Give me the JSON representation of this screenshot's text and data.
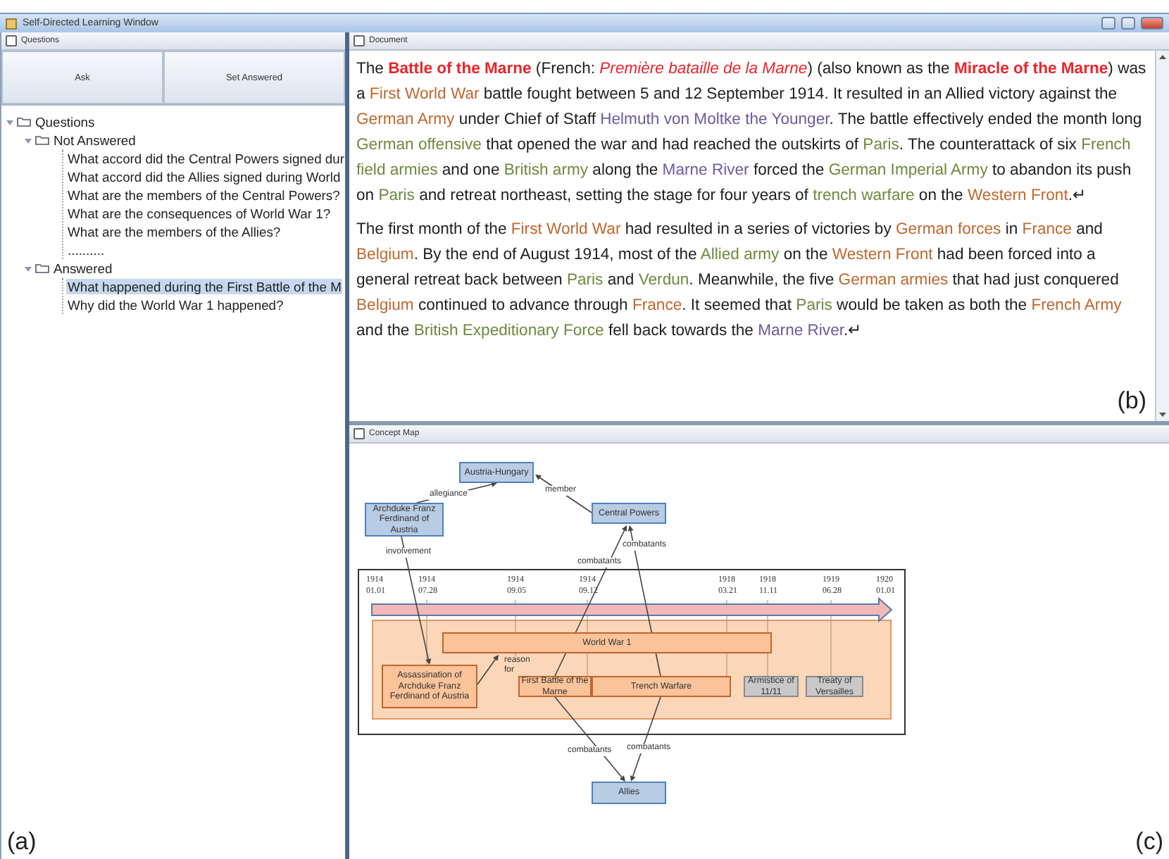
{
  "window": {
    "title": "Self-Directed Learning Window"
  },
  "questions_panel": {
    "title": "Questions",
    "buttons": [
      "Ask",
      "Set Answered"
    ],
    "tree": [
      {
        "label": "Questions",
        "expanded": true,
        "selected": false,
        "children": [
          {
            "label": "Not Answered",
            "expanded": true,
            "selected": false,
            "children": [
              {
                "label": "What accord did the Central Powers signed dur",
                "selected": false
              },
              {
                "label": "What accord did the Allies signed during World",
                "selected": false
              },
              {
                "label": "What are the members of the Central Powers?",
                "selected": false
              },
              {
                "label": "What are the consequences of World War 1?",
                "selected": false
              },
              {
                "label": "What are the members of the Allies?",
                "selected": false
              },
              {
                "label": "..........",
                "selected": false
              }
            ]
          },
          {
            "label": "Answered",
            "expanded": true,
            "selected": false,
            "children": [
              {
                "label": "What happened during the First Battle of the M",
                "selected": true
              },
              {
                "label": "Why did the World War 1 happened?",
                "selected": false
              }
            ]
          }
        ]
      }
    ],
    "caption": "(a)"
  },
  "document_panel": {
    "title": "Document",
    "paragraphs": [
      {
        "segments": [
          {
            "text": "The ",
            "kind": "plain",
            "color": "#1e1e1e"
          },
          {
            "text": "Battle of the Marne",
            "kind": "bold",
            "color": "#e8262a"
          },
          {
            "text": " (French: ",
            "kind": "plain",
            "color": "#1e1e1e"
          },
          {
            "text": "Première bataille de la Marne",
            "kind": "italic",
            "color": "#e8262a"
          },
          {
            "text": ") (also known as the ",
            "kind": "plain",
            "color": "#1e1e1e"
          },
          {
            "text": "Miracle of the Marne",
            "kind": "bold",
            "color": "#e8262a"
          },
          {
            "text": ") was a ",
            "kind": "plain",
            "color": "#1e1e1e"
          },
          {
            "text": "First World War",
            "kind": "plain",
            "color": "#c0672e"
          },
          {
            "text": " battle fought between 5 and 12 September 1914. It resulted in an Allied victory against the ",
            "kind": "plain",
            "color": "#1e1e1e"
          },
          {
            "text": "German Army",
            "kind": "plain",
            "color": "#c0672e"
          },
          {
            "text": " under Chief of Staff ",
            "kind": "plain",
            "color": "#1e1e1e"
          },
          {
            "text": "Helmuth von Moltke the Younger",
            "kind": "plain",
            "color": "#6e5a9c"
          },
          {
            "text": ". The battle effectively ended the month long ",
            "kind": "plain",
            "color": "#1e1e1e"
          },
          {
            "text": "German offensive",
            "kind": "plain",
            "color": "#6b8a3e"
          },
          {
            "text": " that opened the war and had reached the outskirts of ",
            "kind": "plain",
            "color": "#1e1e1e"
          },
          {
            "text": "Paris",
            "kind": "plain",
            "color": "#6b8a3e"
          },
          {
            "text": ". The counterattack of six ",
            "kind": "plain",
            "color": "#1e1e1e"
          },
          {
            "text": "French field armies",
            "kind": "plain",
            "color": "#6b8a3e"
          },
          {
            "text": " and one ",
            "kind": "plain",
            "color": "#1e1e1e"
          },
          {
            "text": "British army",
            "kind": "plain",
            "color": "#6b8a3e"
          },
          {
            "text": " along the ",
            "kind": "plain",
            "color": "#1e1e1e"
          },
          {
            "text": "Marne River",
            "kind": "plain",
            "color": "#6e5a9c"
          },
          {
            "text": " forced the ",
            "kind": "plain",
            "color": "#1e1e1e"
          },
          {
            "text": "German Imperial Army",
            "kind": "plain",
            "color": "#6b8a3e"
          },
          {
            "text": " to abandon its push on ",
            "kind": "plain",
            "color": "#1e1e1e"
          },
          {
            "text": "Paris",
            "kind": "plain",
            "color": "#6b8a3e"
          },
          {
            "text": " and retreat northeast, setting the stage for four years of ",
            "kind": "plain",
            "color": "#1e1e1e"
          },
          {
            "text": "trench warfare",
            "kind": "plain",
            "color": "#6b8a3e"
          },
          {
            "text": " on the ",
            "kind": "plain",
            "color": "#1e1e1e"
          },
          {
            "text": "Western Front",
            "kind": "plain",
            "color": "#c0672e"
          },
          {
            "text": ".↵",
            "kind": "plain",
            "color": "#1e1e1e"
          }
        ]
      },
      {
        "segments": [
          {
            "text": "The first month of the ",
            "kind": "plain",
            "color": "#1e1e1e"
          },
          {
            "text": "First World War",
            "kind": "plain",
            "color": "#c0672e"
          },
          {
            "text": " had resulted in a series of victories by ",
            "kind": "plain",
            "color": "#1e1e1e"
          },
          {
            "text": "German forces",
            "kind": "plain",
            "color": "#c0672e"
          },
          {
            "text": " in ",
            "kind": "plain",
            "color": "#1e1e1e"
          },
          {
            "text": "France",
            "kind": "plain",
            "color": "#c0672e"
          },
          {
            "text": " and ",
            "kind": "plain",
            "color": "#1e1e1e"
          },
          {
            "text": "Belgium",
            "kind": "plain",
            "color": "#c0672e"
          },
          {
            "text": ". By the end of August 1914, most of the ",
            "kind": "plain",
            "color": "#1e1e1e"
          },
          {
            "text": "Allied army",
            "kind": "plain",
            "color": "#6b8a3e"
          },
          {
            "text": " on the ",
            "kind": "plain",
            "color": "#1e1e1e"
          },
          {
            "text": "Western Front",
            "kind": "plain",
            "color": "#c0672e"
          },
          {
            "text": " had been forced into a general retreat back between ",
            "kind": "plain",
            "color": "#1e1e1e"
          },
          {
            "text": "Paris",
            "kind": "plain",
            "color": "#6b8a3e"
          },
          {
            "text": " and ",
            "kind": "plain",
            "color": "#1e1e1e"
          },
          {
            "text": "Verdun",
            "kind": "plain",
            "color": "#6b8a3e"
          },
          {
            "text": ". Meanwhile, the five ",
            "kind": "plain",
            "color": "#1e1e1e"
          },
          {
            "text": "German armies",
            "kind": "plain",
            "color": "#c0672e"
          },
          {
            "text": " that had just conquered ",
            "kind": "plain",
            "color": "#1e1e1e"
          },
          {
            "text": "Belgium",
            "kind": "plain",
            "color": "#c0672e"
          },
          {
            "text": " continued to advance through ",
            "kind": "plain",
            "color": "#1e1e1e"
          },
          {
            "text": "France",
            "kind": "plain",
            "color": "#c0672e"
          },
          {
            "text": ". It seemed that ",
            "kind": "plain",
            "color": "#1e1e1e"
          },
          {
            "text": "Paris",
            "kind": "plain",
            "color": "#6b8a3e"
          },
          {
            "text": " would be taken as both the ",
            "kind": "plain",
            "color": "#1e1e1e"
          },
          {
            "text": "French Army",
            "kind": "plain",
            "color": "#c0672e"
          },
          {
            "text": " and the ",
            "kind": "plain",
            "color": "#1e1e1e"
          },
          {
            "text": "British Expeditionary Force",
            "kind": "plain",
            "color": "#6b8a3e"
          },
          {
            "text": " fell back towards the ",
            "kind": "plain",
            "color": "#1e1e1e"
          },
          {
            "text": "Marne River",
            "kind": "plain",
            "color": "#6e5a9c"
          },
          {
            "text": ".↵",
            "kind": "plain",
            "color": "#1e1e1e"
          }
        ]
      }
    ],
    "caption": "(b)"
  },
  "concept_map": {
    "title": "Concept Map",
    "timeline": {
      "dates": [
        {
          "year": "1914",
          "day": "01.01"
        },
        {
          "year": "1914",
          "day": "07.28"
        },
        {
          "year": "1914",
          "day": "09.05"
        },
        {
          "year": "1914",
          "day": "09.12"
        },
        {
          "year": "1918",
          "day": "03.21"
        },
        {
          "year": "1918",
          "day": "11.11"
        },
        {
          "year": "1919",
          "day": "06.28"
        },
        {
          "year": "1920",
          "day": "01.01"
        }
      ]
    },
    "nodes": [
      {
        "label": "Austria-Hungary",
        "kind": "concept"
      },
      {
        "label": "Archduke Franz Ferdinand of Austria",
        "kind": "concept"
      },
      {
        "label": "Central Powers",
        "kind": "concept"
      },
      {
        "label": "World War 1",
        "kind": "event"
      },
      {
        "label": "Assassination of Archduke Franz Ferdinand of Austria",
        "kind": "event"
      },
      {
        "label": "First Battle of the Marne",
        "kind": "event"
      },
      {
        "label": "Trench Warfare",
        "kind": "event"
      },
      {
        "label": "Armistice of 11/11",
        "kind": "outcome"
      },
      {
        "label": "Treaty of Versailles",
        "kind": "outcome"
      },
      {
        "label": "Allies",
        "kind": "concept"
      }
    ],
    "edges": [
      {
        "label": "allegiance"
      },
      {
        "label": "member"
      },
      {
        "label": "involvement"
      },
      {
        "label": "combatants"
      },
      {
        "label": "combatants"
      },
      {
        "label": "reason for"
      },
      {
        "label": "combatants"
      },
      {
        "label": "combatants"
      }
    ],
    "caption": "(c)"
  }
}
